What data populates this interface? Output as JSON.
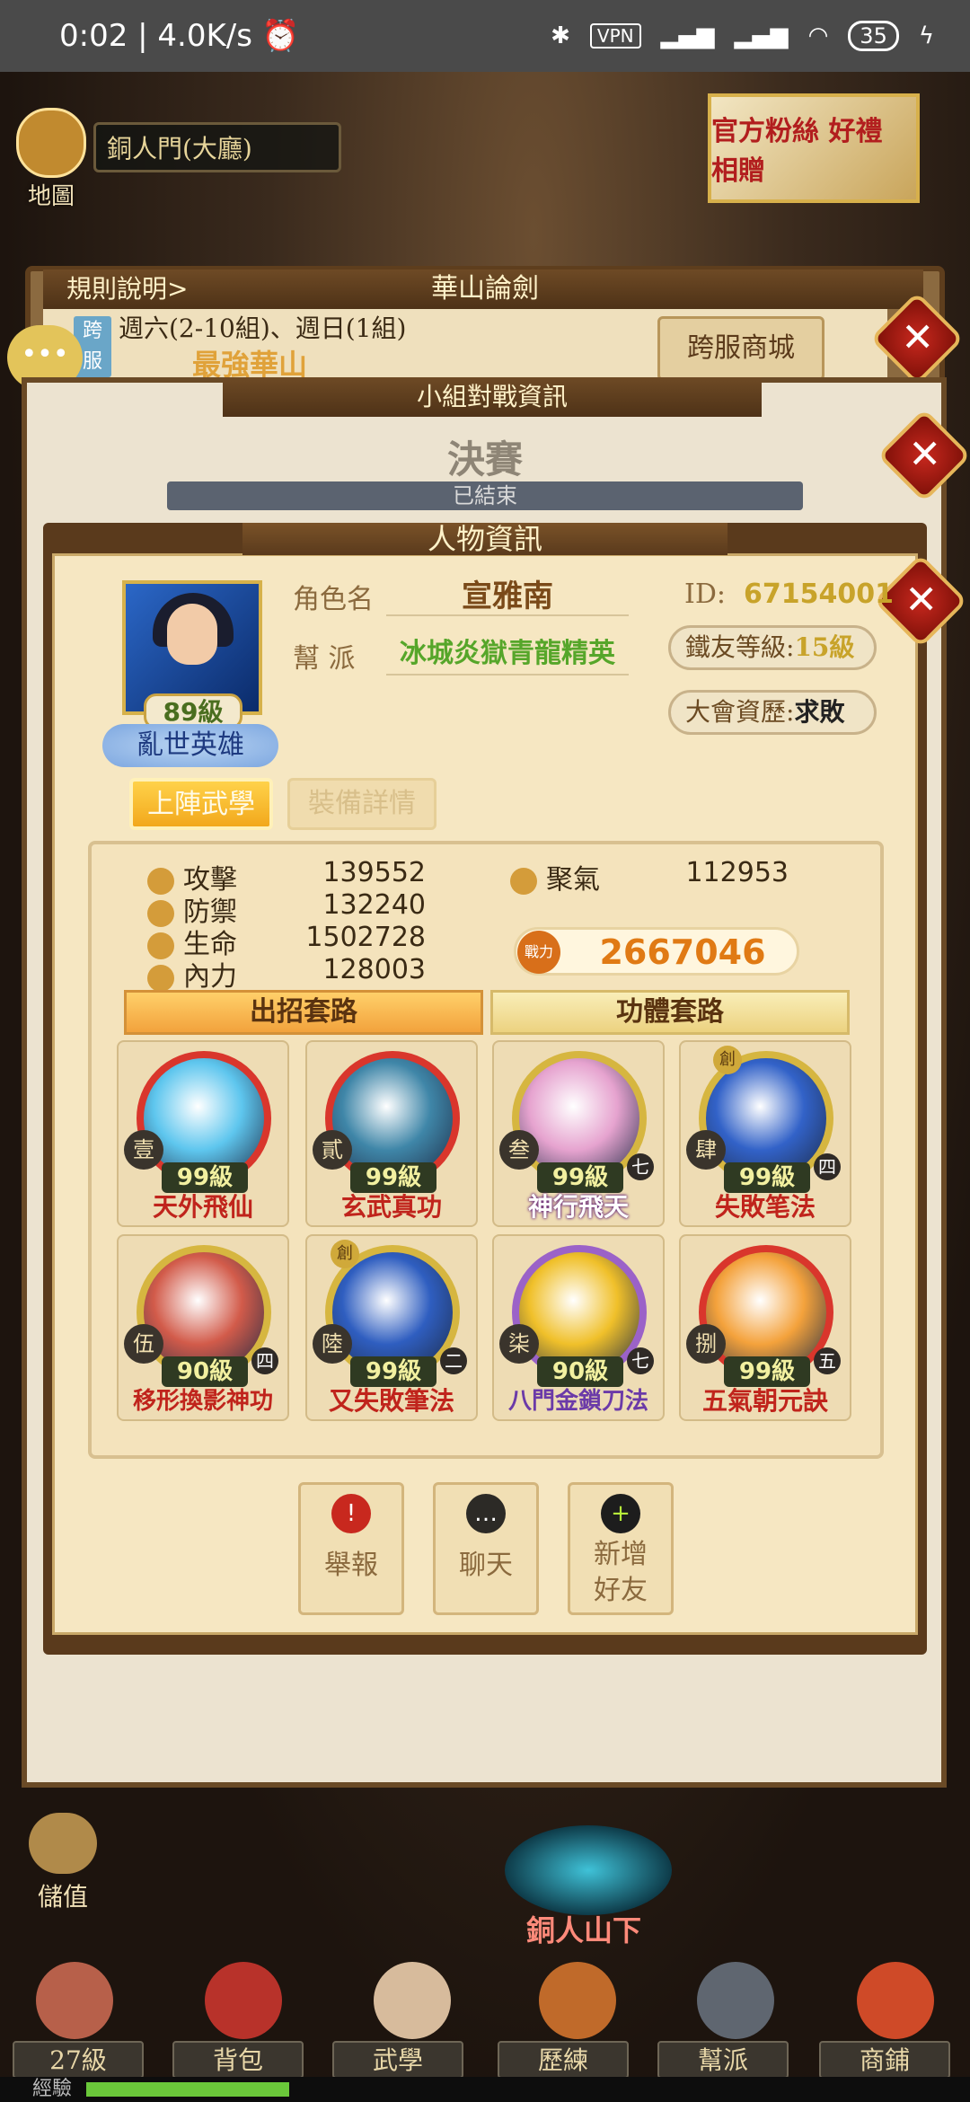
{
  "status_bar": {
    "time": "0:02 | 4.0K/s",
    "vpn": "VPN",
    "battery": "35"
  },
  "top": {
    "map_label": "地圖",
    "location": "銅人門(大廳)",
    "banner_text": "官方粉絲 好禮相贈"
  },
  "huashan": {
    "rules_link": "規則說明>",
    "title": "華山論劍",
    "cross_server_badge": "跨服",
    "schedule": "週六(2-10組)、週日(1組)",
    "strongest": "最強華山",
    "shop_button": "跨服商城"
  },
  "group": {
    "title": "小組對戰資訊",
    "stage": "決賽",
    "status": "已結束"
  },
  "character": {
    "title": "人物資訊",
    "level": "89級",
    "avatar_title": "亂世英雄",
    "name_label": "角色名",
    "name": "宣雅南",
    "guild_label": "幫 派",
    "guild": "冰城炎獄青龍精英",
    "id_label": "ID:",
    "id": "67154001",
    "iron_label": "鐵友等級:",
    "iron_value": "15級",
    "record_label": "大會資歷:",
    "record_value": "求敗",
    "tabs": {
      "skills": "上陣武學",
      "equip": "裝備詳情"
    },
    "stats": {
      "attack_label": "攻擊",
      "attack": "139552",
      "defense_label": "防禦",
      "defense": "132240",
      "hp_label": "生命",
      "hp": "1502728",
      "inner_label": "內力",
      "inner": "128003",
      "qi_label": "聚氣",
      "qi": "112953",
      "power_icon": "戰力",
      "power": "2667046"
    },
    "sections": {
      "attack_set": "出招套路",
      "body_set": "功體套路"
    },
    "skills": [
      {
        "rank": "壹",
        "level": "99級",
        "name": "天外飛仙",
        "stage": "",
        "name_color": "#c0241c",
        "ring": "#d9362c",
        "fill": "#5ec6ee"
      },
      {
        "rank": "貳",
        "level": "99級",
        "name": "玄武真功",
        "stage": "",
        "name_color": "#c0241c",
        "ring": "#d9362c",
        "fill": "#3f86a8"
      },
      {
        "rank": "叁",
        "level": "99級",
        "name": "神行飛天",
        "stage": "七",
        "name_color": "#ffffff",
        "ring": "#d6b640",
        "fill": "#e6a3cf"
      },
      {
        "rank": "肆",
        "level": "99級",
        "name": "失敗笔法",
        "stage": "四",
        "name_color": "#c0241c",
        "ring": "#d6b640",
        "fill": "#3262c8"
      },
      {
        "rank": "伍",
        "level": "90級",
        "name": "移形換影神功",
        "stage": "四",
        "name_color": "#c0241c",
        "ring": "#d6b640",
        "fill": "#d25b4a"
      },
      {
        "rank": "陸",
        "level": "99級",
        "name": "又失敗筆法",
        "stage": "二",
        "name_color": "#c0241c",
        "ring": "#d6b640",
        "fill": "#2f5ec0"
      },
      {
        "rank": "柒",
        "level": "90級",
        "name": "八門金鎖刀法",
        "stage": "七",
        "name_color": "#6b3aa8",
        "ring": "#9b62c8",
        "fill": "#f0c02a"
      },
      {
        "rank": "捌",
        "level": "99級",
        "name": "五氣朝元訣",
        "stage": "五",
        "name_color": "#c0241c",
        "ring": "#d9362c",
        "fill": "#f4a23c"
      }
    ],
    "badges": {
      "skill4": "創",
      "skill6": "創"
    },
    "actions": [
      {
        "icon": "!",
        "label": "舉報"
      },
      {
        "icon": "…",
        "label": "聊天"
      },
      {
        "icon": "+",
        "label": "新增\n好友"
      }
    ]
  },
  "bottom": {
    "deposit": "儲值",
    "portal_label": "銅人山下",
    "nav": [
      "27級",
      "背包",
      "武學",
      "歷練",
      "幫派",
      "商鋪"
    ],
    "xp_label": "經驗",
    "xp_progress": 0.23
  },
  "colors": {
    "accent_gold": "#c8a32a",
    "power_orange": "#e07a14",
    "close_red": "#c8281e"
  }
}
